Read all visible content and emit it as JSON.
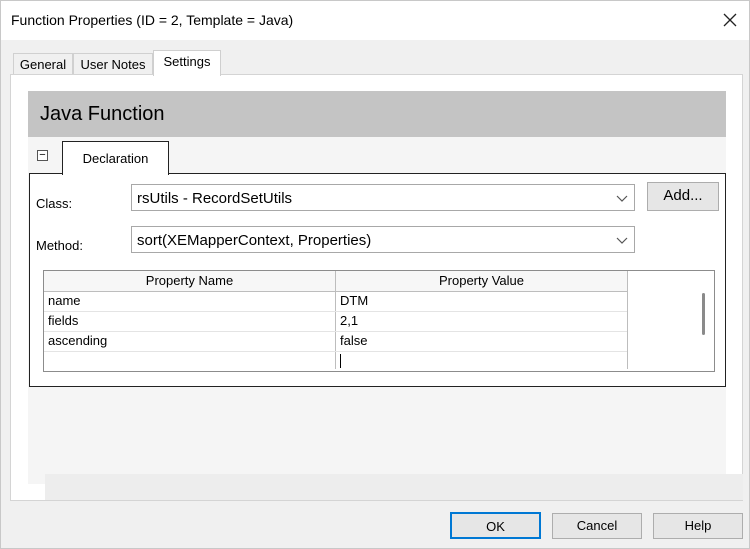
{
  "window": {
    "title": "Function Properties (ID = 2, Template = Java)",
    "close_icon": "close-icon"
  },
  "tabs": [
    {
      "label": "General"
    },
    {
      "label": "User Notes"
    },
    {
      "label": "Settings",
      "active": true
    }
  ],
  "settings": {
    "header_title": "Java Function",
    "declaration_tab": "Declaration",
    "class_label": "Class:",
    "class_value": "rsUtils - RecordSetUtils",
    "add_button": "Add...",
    "method_label": "Method:",
    "method_value": "sort(XEMapperContext, Properties)",
    "grid": {
      "columns": [
        "Property Name",
        "Property Value"
      ],
      "rows": [
        [
          "name",
          "DTM"
        ],
        [
          "fields",
          "2,1"
        ],
        [
          "ascending",
          "false"
        ],
        [
          "",
          ""
        ]
      ]
    }
  },
  "buttons": {
    "ok": "OK",
    "cancel": "Cancel",
    "help": "Help"
  },
  "colors": {
    "header_band": "#c4c4c4",
    "accent_border": "#0078d4"
  }
}
